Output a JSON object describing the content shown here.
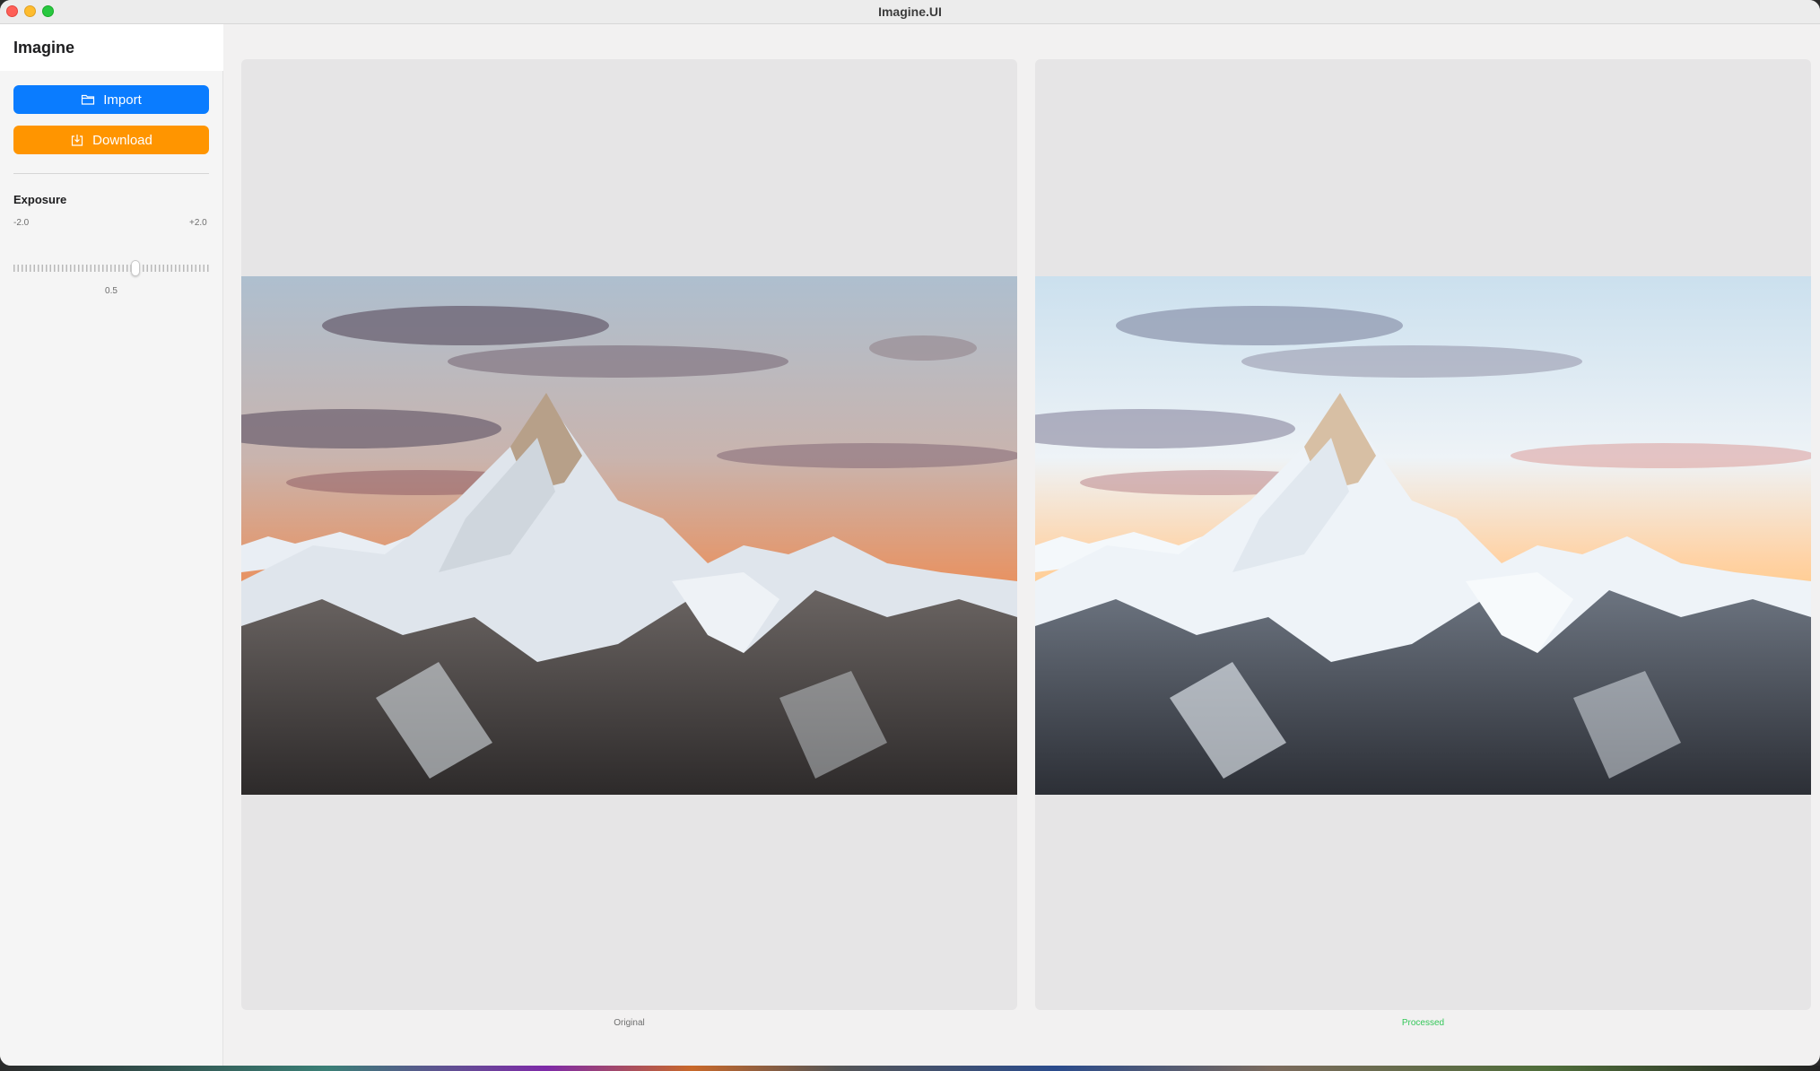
{
  "window": {
    "title": "Imagine.UI"
  },
  "sidebar": {
    "app_name": "Imagine",
    "import_label": "Import",
    "download_label": "Download",
    "exposure": {
      "title": "Exposure",
      "min_label": "-2.0",
      "max_label": "+2.0",
      "min": -2.0,
      "max": 2.0,
      "value": 0.5,
      "value_label": "0.5"
    }
  },
  "main": {
    "original_caption": "Original",
    "processed_caption": "Processed"
  },
  "colors": {
    "import_button": "#0a7cff",
    "download_button": "#ff9500",
    "processed_caption": "#34c759"
  },
  "icons": {
    "import": "folder-icon",
    "download": "download-tray-icon"
  }
}
